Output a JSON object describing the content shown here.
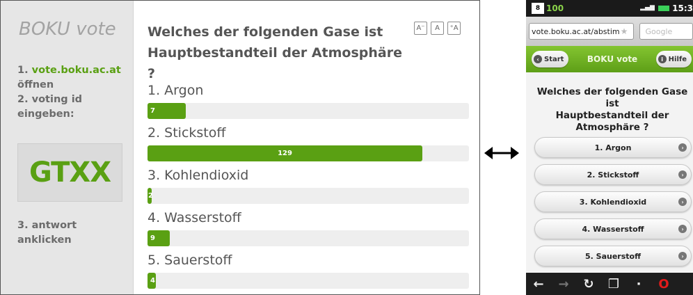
{
  "results": {
    "brand": "BOKU vote",
    "step1_number": "1.",
    "step1_url": "vote.boku.ac.at",
    "step1_action": "öffnen",
    "step2_line1": "2. voting id",
    "step2_line2": "eingeben:",
    "voting_code": "GTXX",
    "step3_line1": "3. antwort",
    "step3_line2": "anklicken",
    "question_line1": "Welches der folgenden Gase ist",
    "question_line2": "Hauptbestandteil der Atmosphäre ?",
    "font_buttons": [
      "A⁻",
      "A",
      "⁺A"
    ],
    "answers": [
      {
        "label": "1. Argon",
        "votes": "7"
      },
      {
        "label": "2. Stickstoff",
        "votes": "129"
      },
      {
        "label": "3. Kohlendioxid",
        "votes": "2"
      },
      {
        "label": "4. Wasserstoff",
        "votes": "9"
      },
      {
        "label": "5. Sauerstoff",
        "votes": "4"
      }
    ]
  },
  "chart_data": {
    "type": "bar",
    "categories": [
      "1. Argon",
      "2. Stickstoff",
      "3. Kohlendioxid",
      "4. Wasserstoff",
      "5. Sauerstoff"
    ],
    "values": [
      7,
      129,
      2,
      9,
      4
    ],
    "title": "Welches der folgenden Gase ist Hauptbestandteil der Atmosphäre ?",
    "xlabel": "",
    "ylabel": "",
    "bar_fill_fraction": [
      0.12,
      0.855,
      0.01,
      0.07,
      0.025
    ],
    "bar_color": "#5aa013"
  },
  "phone": {
    "notification": "8",
    "battery_text": "100",
    "clock": "15:3",
    "url": "vote.boku.ac.at/abstim",
    "search_placeholder": "Google",
    "start_label": "Start",
    "header_title": "BOKU vote",
    "help_label": "Hilfe",
    "question_line1": "Welches der folgenden Gase ist",
    "question_line2": "Hauptbestandteil der",
    "question_line3": "Atmosphäre ?",
    "answers": [
      "1. Argon",
      "2. Stickstoff",
      "3. Kohlendioxid",
      "4. Wasserstoff",
      "5. Sauerstoff"
    ]
  },
  "colors": {
    "accent": "#5aa013",
    "header_green": "#6db022"
  },
  "icons": {
    "arrow": "double-arrow-icon",
    "star": "star-icon",
    "go": "chevron-right-icon"
  }
}
